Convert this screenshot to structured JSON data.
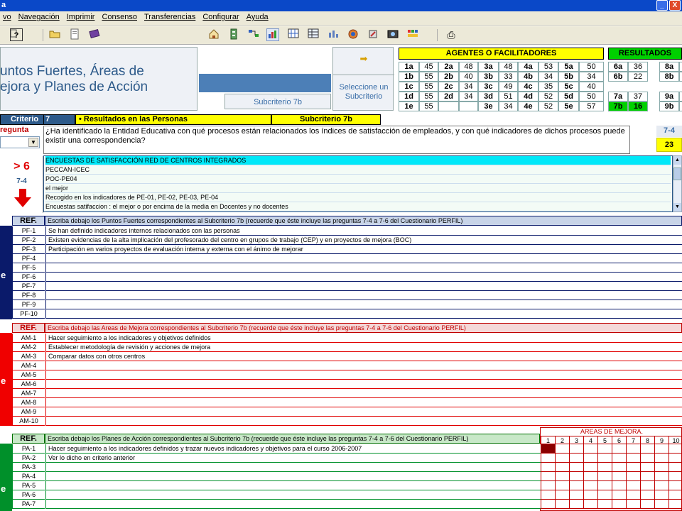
{
  "window": {
    "title": "a",
    "minimize": "_",
    "close": "X"
  },
  "menu": [
    "vo",
    "Navegación",
    "Imprimir",
    "Consenso",
    "Transferencias",
    "Configurar",
    "Ayuda"
  ],
  "toolbar": {
    "help_glyph": "?",
    "print_glyph": "⎙"
  },
  "header": {
    "title_line1": "untos Fuertes, Áreas de",
    "title_line2": "ejora y Planes de Acción",
    "subcriterio_label": "Subcriterio 7b",
    "select_label": "Seleccione un Subcriterio",
    "select_arrow": "➡"
  },
  "agentes": {
    "title": "AGENTES O FACILITADORES",
    "rows": [
      [
        "1a",
        "45",
        "2a",
        "48",
        "3a",
        "48",
        "4a",
        "53",
        "5a",
        "50"
      ],
      [
        "1b",
        "55",
        "2b",
        "40",
        "3b",
        "33",
        "4b",
        "34",
        "5b",
        "34"
      ],
      [
        "1c",
        "55",
        "2c",
        "34",
        "3c",
        "49",
        "4c",
        "35",
        "5c",
        "40"
      ],
      [
        "1d",
        "55",
        "2d",
        "34",
        "3d",
        "51",
        "4d",
        "52",
        "5d",
        "50"
      ],
      [
        "1e",
        "55",
        "",
        "",
        "3e",
        "34",
        "4e",
        "52",
        "5e",
        "57"
      ]
    ]
  },
  "resultados": {
    "title": "RESULTADOS",
    "rows": [
      [
        "6a",
        "36",
        "8a",
        ""
      ],
      [
        "6b",
        "22",
        "8b",
        ""
      ],
      [
        "",
        "",
        "",
        ""
      ],
      [
        "7a",
        "37",
        "9a",
        ""
      ],
      [
        "7b",
        "16",
        "9b",
        ""
      ]
    ]
  },
  "criterio": {
    "label": "Criterio",
    "number": "7",
    "name": "• Resultados en las Personas",
    "subcriterio": "Subcriterio 7b"
  },
  "pregunta": {
    "label": "regunta",
    "question": "¿Ha identificado la Entidad Educativa con qué procesos están relacionados los índices de satisfacción de empleados, y con qué indicadores de dichos procesos puede existir una correspondencia?",
    "ref": "7-4",
    "score": "23"
  },
  "encuestas": {
    "gt": "> 6",
    "ref": "7-4",
    "items": [
      "ENCUESTAS DE SATISFACCIÓN RED DE CENTROS INTEGRADOS",
      "PECCAN-ICEC",
      "POC-PE04",
      "el mejor",
      "Recogido en los indicadores de PE-01, PE-02, PE-03, PE-04",
      "Encuestas satifaccion : el mejor o por encima de la media en Docentes y no docentes"
    ]
  },
  "puntos_fuertes": {
    "ref_header": "REF.",
    "header": "Escriba debajo los Puntos Fuertes correspondientes al Subcriterio 7b (recuerde que éste incluye las preguntas 7-4 a 7-6 del Cuestionario PERFIL)",
    "side": "e",
    "rows": [
      {
        "ref": "PF-1",
        "text": "Se han definido indicadores internos relacionados con las personas"
      },
      {
        "ref": "PF-2",
        "text": "Existen evidencias de la alta implicación del profesorado del centro en grupos de trabajo (CEP) y en proyectos de mejora (BOC)"
      },
      {
        "ref": "PF-3",
        "text": "Participación en varios proyectos de evaluación interna y externa con el ánimo de mejorar"
      },
      {
        "ref": "PF-4",
        "text": ""
      },
      {
        "ref": "PF-5",
        "text": ""
      },
      {
        "ref": "PF-6",
        "text": ""
      },
      {
        "ref": "PF-7",
        "text": ""
      },
      {
        "ref": "PF-8",
        "text": ""
      },
      {
        "ref": "PF-9",
        "text": ""
      },
      {
        "ref": "PF-10",
        "text": ""
      }
    ]
  },
  "areas_mejora": {
    "ref_header": "REF.",
    "header": "Escriba debajo las Areas de Mejora correspondientes al Subcriterio 7b (recuerde que éste incluye las preguntas 7-4 a 7-6 del Cuestionario PERFIL)",
    "side": "e",
    "rows": [
      {
        "ref": "AM-1",
        "text": "Hacer seguimiento a los indicadores y objetivos definidos"
      },
      {
        "ref": "AM-2",
        "text": "Establecer metodología de revisión y acciones de mejora"
      },
      {
        "ref": "AM-3",
        "text": "Comparar datos con otros centros"
      },
      {
        "ref": "AM-4",
        "text": ""
      },
      {
        "ref": "AM-5",
        "text": ""
      },
      {
        "ref": "AM-6",
        "text": ""
      },
      {
        "ref": "AM-7",
        "text": ""
      },
      {
        "ref": "AM-8",
        "text": ""
      },
      {
        "ref": "AM-9",
        "text": ""
      },
      {
        "ref": "AM-10",
        "text": ""
      }
    ]
  },
  "planes_accion": {
    "ref_header": "REF.",
    "header": "Escriba debajo los Planes de Acción correspondientes al Subcriterio 7b (recuerde que éste incluye las preguntas 7-4 a 7-6 del Cuestionario PERFIL)",
    "side": "e",
    "grid_title": "AREAS DE MEJORA.",
    "grid_cols": [
      "1",
      "2",
      "3",
      "4",
      "5",
      "6",
      "7",
      "8",
      "9",
      "10"
    ],
    "rows": [
      {
        "ref": "PA-1",
        "text": "Hacer seguimiento a los indicadores definidos y trazar nuevos indicadores y objetivos para el curso 2006-2007"
      },
      {
        "ref": "PA-2",
        "text": "Ver lo dicho en criterio anterior"
      },
      {
        "ref": "PA-3",
        "text": ""
      },
      {
        "ref": "PA-4",
        "text": ""
      },
      {
        "ref": "PA-5",
        "text": ""
      },
      {
        "ref": "PA-6",
        "text": ""
      },
      {
        "ref": "PA-7",
        "text": ""
      }
    ]
  },
  "colors": {
    "pf": "#0a1a6a",
    "am": "#e00000",
    "pa": "#00902a",
    "yellow": "#ffff00",
    "green": "#00d000"
  }
}
